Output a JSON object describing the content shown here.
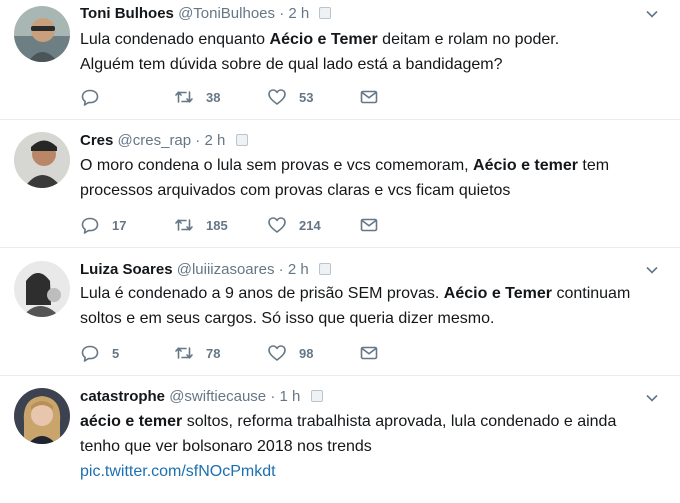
{
  "tweets": [
    {
      "fullname": "Toni Bulhoes",
      "handle": "@ToniBulhoes",
      "time": "2 h",
      "lines": [
        [
          "Lula condenado enquanto ",
          "Aécio e Temer",
          " deitam e rolam no poder."
        ],
        [
          "Alguém tem dúvida sobre de qual lado está a bandidagem?",
          "",
          ""
        ]
      ],
      "replies": "",
      "retweets": "38",
      "likes": "53"
    },
    {
      "fullname": "Cres",
      "handle": "@cres_rap",
      "time": "2 h",
      "lines": [
        [
          "O moro condena o lula sem provas e vcs comemoram, ",
          "Aécio e temer",
          " tem"
        ],
        [
          "processos arquivados com provas claras e vcs ficam quietos",
          "",
          ""
        ]
      ],
      "replies": "17",
      "retweets": "185",
      "likes": "214"
    },
    {
      "fullname": "Luiza Soares",
      "handle": "@luiiizasoares",
      "time": "2 h",
      "lines": [
        [
          "Lula é condenado a 9 anos de prisão SEM provas. ",
          "Aécio e Temer",
          " continuam"
        ],
        [
          "soltos e em seus cargos. Só isso que queria dizer mesmo.",
          "",
          ""
        ]
      ],
      "replies": "5",
      "retweets": "78",
      "likes": "98"
    },
    {
      "fullname": "catastrophe",
      "handle": "@swiftiecause",
      "time": "1 h",
      "lines": [
        [
          "",
          "aécio e temer",
          " soltos, reforma trabalhista aprovada, lula condenado e ainda"
        ],
        [
          "tenho que ver bolsonaro 2018 nos trends",
          "",
          ""
        ]
      ],
      "link": "pic.twitter.com/sfNOcPmkdt"
    }
  ],
  "time_separator": "·",
  "colors": {
    "text": "#14171a",
    "meta": "#657786",
    "link": "#1c6fb0",
    "divider": "#e6ecf0"
  },
  "icons": [
    "reply-icon",
    "retweet-icon",
    "like-icon",
    "direct-message-icon",
    "chevron-down-icon",
    "verified-emblem-icon"
  ]
}
